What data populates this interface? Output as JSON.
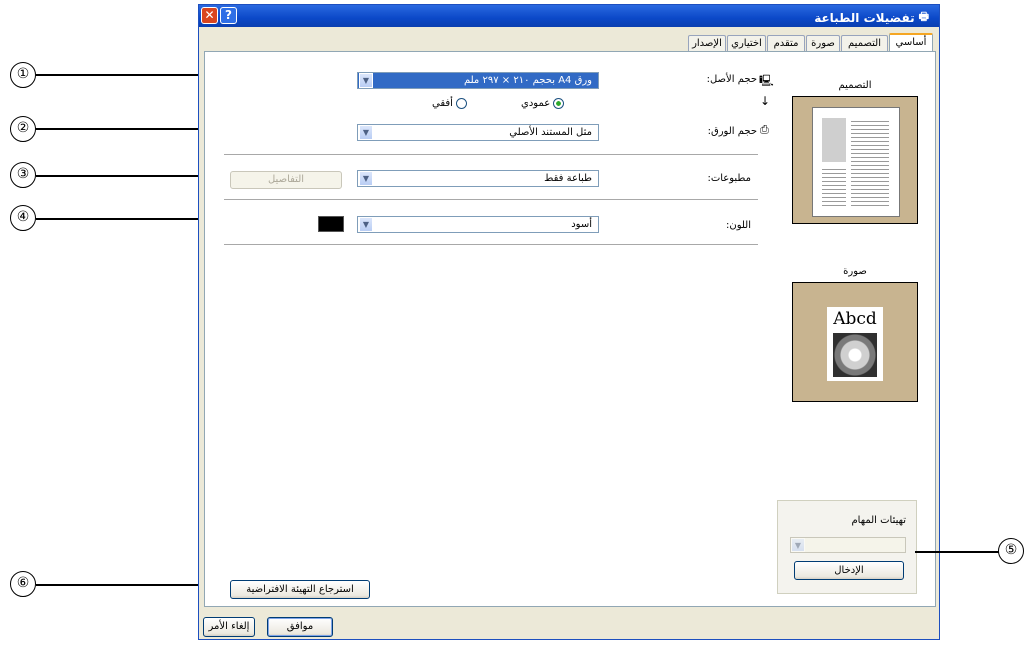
{
  "window": {
    "title": "تفضيلات الطباعة",
    "help_label": "?",
    "close_label": "✕"
  },
  "tabs": [
    "أساسي",
    "التصميم",
    "صورة",
    "متقدم",
    "اختياري",
    "الإصدار"
  ],
  "original_size": {
    "label": "حجم الأصل:",
    "value": "ورق A4 بحجم ٢١٠ × ٢٩٧ ملم"
  },
  "orientation": {
    "portrait": "عمودي",
    "landscape": "أفقي",
    "selected": "portrait"
  },
  "paper_size": {
    "label": "حجم الورق:",
    "value": "مثل المستند الأصلي"
  },
  "print_type": {
    "label": "مطبوعات:",
    "value": "طباعة فقط",
    "details_label": "التفاصيل"
  },
  "color": {
    "label": "اللون:",
    "value": "أسود",
    "swatch": "#000000"
  },
  "preview": {
    "layout_label": "التصميم",
    "image_label": "صورة",
    "sample_text": "Abcd"
  },
  "job_settings": {
    "label": "تهيئات المهام",
    "input_label": "الإدخال"
  },
  "restore_label": "استرجاع التهيئة الافتراضية",
  "ok_label": "موافق",
  "cancel_label": "إلغاء الأمر",
  "callouts": [
    "①",
    "②",
    "③",
    "④",
    "⑤",
    "⑥"
  ]
}
